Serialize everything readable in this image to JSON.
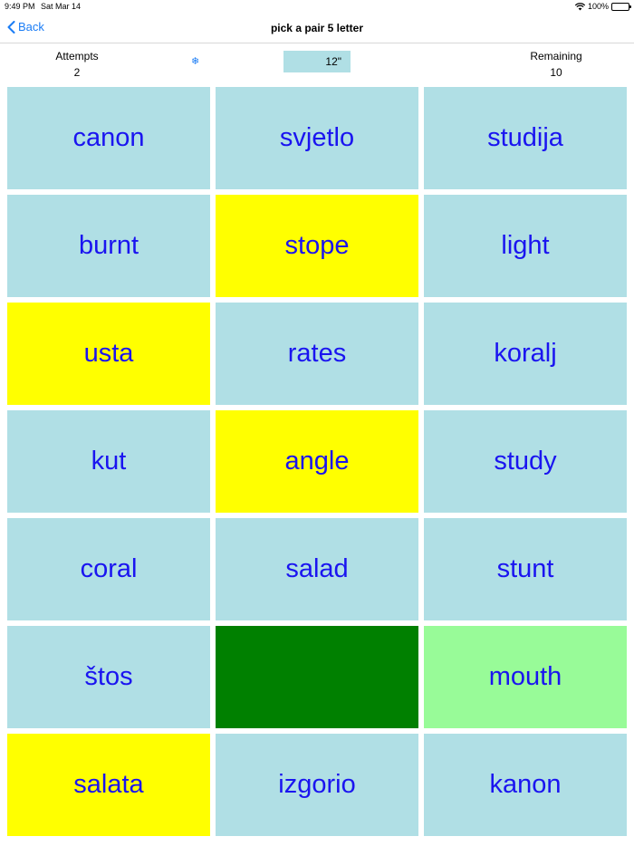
{
  "status": {
    "time": "9:49 PM",
    "date": "Sat Mar 14",
    "battery": "100%"
  },
  "nav": {
    "back_label": "Back",
    "title": "pick a pair 5 letter"
  },
  "stats": {
    "attempts_label": "Attempts",
    "attempts_value": "2",
    "remaining_label": "Remaining",
    "remaining_value": "10",
    "timer": "12\""
  },
  "colors": {
    "tile_default": "#b0dfe5",
    "selected": "#ffff00",
    "matched": "#008000",
    "hint": "#98fb98",
    "text": "#1a14f0",
    "accent": "#1a7cf5"
  },
  "tiles": [
    {
      "word": "canon",
      "state": "blue"
    },
    {
      "word": "svjetlo",
      "state": "blue"
    },
    {
      "word": "studija",
      "state": "blue"
    },
    {
      "word": "burnt",
      "state": "blue"
    },
    {
      "word": "stope",
      "state": "yellow"
    },
    {
      "word": "light",
      "state": "blue"
    },
    {
      "word": "usta",
      "state": "yellow"
    },
    {
      "word": "rates",
      "state": "blue"
    },
    {
      "word": "koralj",
      "state": "blue"
    },
    {
      "word": "kut",
      "state": "blue"
    },
    {
      "word": "angle",
      "state": "yellow"
    },
    {
      "word": "study",
      "state": "blue"
    },
    {
      "word": "coral",
      "state": "blue"
    },
    {
      "word": "salad",
      "state": "blue"
    },
    {
      "word": "stunt",
      "state": "blue"
    },
    {
      "word": "štos",
      "state": "blue"
    },
    {
      "word": "",
      "state": "green"
    },
    {
      "word": "mouth",
      "state": "lightgreen"
    },
    {
      "word": "salata",
      "state": "yellow"
    },
    {
      "word": "izgorio",
      "state": "blue"
    },
    {
      "word": "kanon",
      "state": "blue"
    }
  ]
}
